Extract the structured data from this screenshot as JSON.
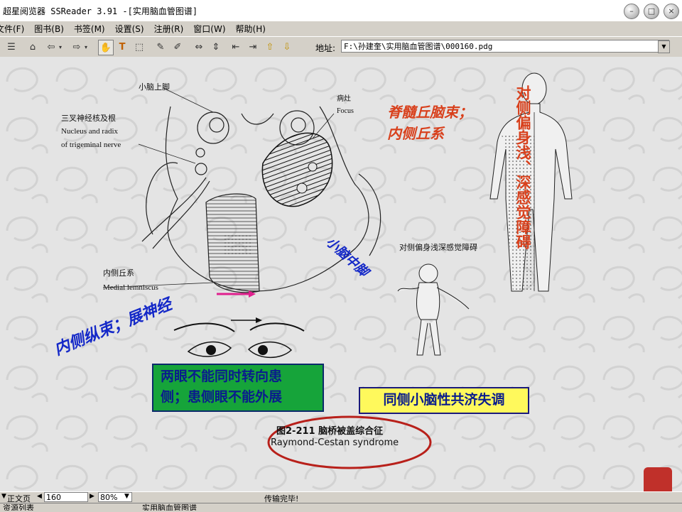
{
  "window": {
    "title": "超星阅览器 SSReader 3.91 -[实用脑血管图谱]"
  },
  "menu": {
    "items": [
      "文件(F)",
      "图书(B)",
      "书签(M)",
      "设置(S)",
      "注册(R)",
      "窗口(W)",
      "帮助(H)"
    ]
  },
  "toolbar": {
    "address_label": "地址:",
    "address_value": "F:\\孙建奎\\实用脑血管图谱\\000160.pdg"
  },
  "figure": {
    "labels": {
      "cerebellar_peduncle": "小脑上脚",
      "trigeminal_cn": "三叉神经核及根",
      "trigeminal_en1": "Nucleus and radix",
      "trigeminal_en2": "of trigeminal nerve",
      "focus_cn": "病灶",
      "focus_en": "Focus",
      "medial_lemniscus_cn": "内侧丘系",
      "medial_lemniscus_en": "Medial lemniscus",
      "contralateral_cn": "对侧偏身浅深感觉障碍"
    },
    "caption_cn": "图2-211   脑桥被盖综合征",
    "caption_en": "Raymond-Cestan syndrome"
  },
  "annotations": {
    "spinothalamic_line1": "脊髓丘脑束；",
    "spinothalamic_line2": "内侧丘系",
    "contralateral_vertical": "对侧偏身浅、深感觉障碍",
    "mlf": "内侧纵束；展神经",
    "cerebellar_tract": "小脑中脚",
    "eye_line1": "两眼不能同时转向患",
    "eye_line2": "侧；患侧眼不能外展",
    "ataxia": "同侧小脑性共济失调"
  },
  "status": {
    "page_label": "正文页",
    "page_number": "160",
    "zoom": "80%",
    "status_text": "传输完毕!"
  },
  "bottom": {
    "left_tab": "资源列表",
    "right_tab": "实用脑血管图谱"
  },
  "colors": {
    "red_annotation": "#d8401c",
    "blue_annotation": "#1428c8",
    "green_box": "#16a43a",
    "yellow_box": "#fff95c"
  }
}
